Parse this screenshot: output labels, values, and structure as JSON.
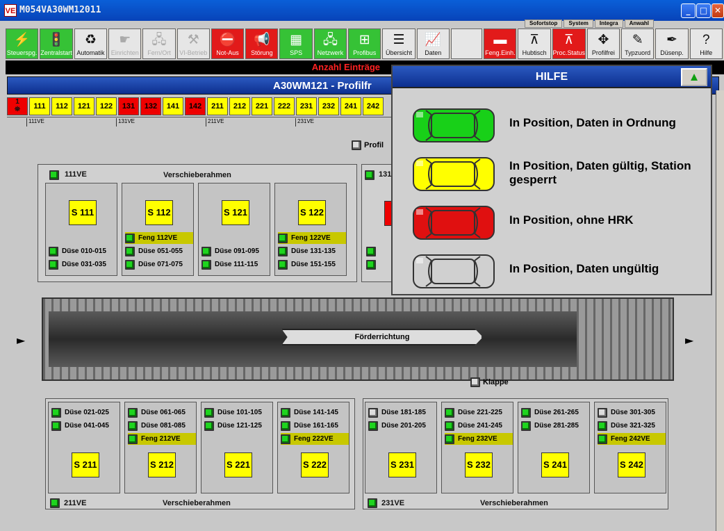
{
  "window": {
    "title": "M054VA30WM12011",
    "icon": "VE"
  },
  "top_tabs": [
    "Sofortstop",
    "System",
    "Integra",
    "Anwahl"
  ],
  "toolbar": [
    {
      "label": "Steuerspg.",
      "icon": "lightning-icon",
      "glyph": "⚡",
      "style": "green"
    },
    {
      "label": "Zentralstart",
      "icon": "traffic-light-icon",
      "glyph": "🚦",
      "style": "green"
    },
    {
      "label": "Automatik",
      "icon": "cycle-icon",
      "glyph": "♻",
      "style": "gray"
    },
    {
      "label": "Einrichten",
      "icon": "hand-icon",
      "glyph": "☛",
      "style": "gray-dis"
    },
    {
      "label": "Fern/Ort",
      "icon": "network-pc-icon",
      "glyph": "🖧",
      "style": "gray-dis"
    },
    {
      "label": "VI-Betrieb",
      "icon": "tools-icon",
      "glyph": "⚒",
      "style": "gray-dis"
    },
    {
      "label": "Not-Aus",
      "icon": "stop-icon",
      "glyph": "⛔",
      "style": "red"
    },
    {
      "label": "Störung",
      "icon": "horn-icon",
      "glyph": "📢",
      "style": "red"
    },
    {
      "label": "SPS",
      "icon": "plc-icon",
      "glyph": "▦",
      "style": "green"
    },
    {
      "label": "Netzwerk",
      "icon": "network-icon",
      "glyph": "🖧",
      "style": "green"
    },
    {
      "label": "Profibus",
      "icon": "bus-icon",
      "glyph": "⊞",
      "style": "green"
    },
    {
      "label": "Übersicht",
      "icon": "list-icon",
      "glyph": "☰",
      "style": "gray"
    },
    {
      "label": "Daten",
      "icon": "chart-icon",
      "glyph": "📈",
      "style": "gray"
    },
    {
      "label": "",
      "icon": "blank-icon",
      "glyph": "",
      "style": "gray"
    },
    {
      "label": "Feng.Einh.",
      "icon": "feng-icon",
      "glyph": "▬",
      "style": "red"
    },
    {
      "label": "Hubtisch",
      "icon": "lift-table-icon",
      "glyph": "⊼",
      "style": "gray"
    },
    {
      "label": "Proc.Status",
      "icon": "process-icon",
      "glyph": "⊼",
      "style": "red"
    },
    {
      "label": "Profilfrei",
      "icon": "arrows-icon",
      "glyph": "✥",
      "style": "gray"
    },
    {
      "label": "Typzuord",
      "icon": "type-assign-icon",
      "glyph": "✎",
      "style": "gray"
    },
    {
      "label": "Düsenp.",
      "icon": "nozzle-icon",
      "glyph": "✒",
      "style": "gray"
    },
    {
      "label": "Hilfe",
      "icon": "help-icon",
      "glyph": "?",
      "style": "gray"
    }
  ],
  "status_text": "Anzahl Einträge",
  "header_title": "A30WM121 - Profilfr",
  "stations": [
    {
      "label": "111",
      "color": "yellow"
    },
    {
      "label": "112",
      "color": "yellow"
    },
    {
      "label": "121",
      "color": "yellow"
    },
    {
      "label": "122",
      "color": "yellow"
    },
    {
      "label": "131",
      "color": "red"
    },
    {
      "label": "132",
      "color": "red"
    },
    {
      "label": "141",
      "color": "yellow"
    },
    {
      "label": "142",
      "color": "red"
    },
    {
      "label": "211",
      "color": "yellow"
    },
    {
      "label": "212",
      "color": "yellow"
    },
    {
      "label": "221",
      "color": "yellow"
    },
    {
      "label": "222",
      "color": "yellow"
    },
    {
      "label": "231",
      "color": "yellow"
    },
    {
      "label": "232",
      "color": "yellow"
    },
    {
      "label": "241",
      "color": "yellow"
    },
    {
      "label": "242",
      "color": "yellow"
    }
  ],
  "first_station": "1",
  "ruler": [
    "111VE",
    "131VE",
    "211VE",
    "231VE"
  ],
  "profil_label": "Profil",
  "top_frame": {
    "ve": "111VE",
    "title": "Verschieberahmen",
    "ve2": "131"
  },
  "bottom_frame_left": {
    "ve": "211VE",
    "title": "Verschieberahmen"
  },
  "bottom_frame_right": {
    "ve": "231VE",
    "title": "Verschieberahmen"
  },
  "top_cells": [
    {
      "station": "S 111",
      "feng": "",
      "rows": [
        "Düse 010-015",
        "Düse 031-035"
      ]
    },
    {
      "station": "S 112",
      "feng": "Feng 112VE",
      "rows": [
        "Düse 051-055",
        "Düse 071-075"
      ]
    },
    {
      "station": "S 121",
      "feng": "",
      "rows": [
        "Düse 091-095",
        "Düse 111-115"
      ]
    },
    {
      "station": "S 122",
      "feng": "Feng 122VE",
      "rows": [
        "Düse 131-135",
        "Düse 151-155"
      ]
    }
  ],
  "bottom_cells": [
    {
      "station": "S 211",
      "feng": "",
      "rows": [
        "Düse 021-025",
        "Düse 041-045"
      ],
      "leds": [
        "green",
        "green"
      ]
    },
    {
      "station": "S 212",
      "feng": "Feng 212VE",
      "rows": [
        "Düse 061-065",
        "Düse 081-085"
      ],
      "leds": [
        "green",
        "green"
      ]
    },
    {
      "station": "S 221",
      "feng": "",
      "rows": [
        "Düse 101-105",
        "Düse 121-125"
      ],
      "leds": [
        "green",
        "green"
      ]
    },
    {
      "station": "S 222",
      "feng": "Feng 222VE",
      "rows": [
        "Düse 141-145",
        "Düse 161-165"
      ],
      "leds": [
        "green",
        "green"
      ]
    },
    {
      "station": "S 231",
      "feng": "",
      "rows": [
        "Düse 181-185",
        "Düse 201-205"
      ],
      "leds": [
        "gray",
        "green"
      ]
    },
    {
      "station": "S 232",
      "feng": "Feng 232VE",
      "rows": [
        "Düse 221-225",
        "Düse 241-245"
      ],
      "leds": [
        "green",
        "green"
      ]
    },
    {
      "station": "S 241",
      "feng": "",
      "rows": [
        "Düse 261-265",
        "Düse 281-285"
      ],
      "leds": [
        "green",
        "green"
      ]
    },
    {
      "station": "S 242",
      "feng": "Feng 242VE",
      "rows": [
        "Düse 301-305",
        "Düse 321-325"
      ],
      "leds": [
        "gray",
        "green"
      ]
    }
  ],
  "conveyor_label": "Förderrichtung",
  "klappe_label": "Klappe",
  "hilfe": {
    "title": "HILFE",
    "legend": [
      {
        "color": "#18d018",
        "text": "In Position, Daten in Ordnung"
      },
      {
        "color": "#ffff00",
        "text": "In Position, Daten gültig, Station gesperrt"
      },
      {
        "color": "#e01010",
        "text": "In Position, ohne HRK"
      },
      {
        "color": "#d0d0d0",
        "text": "In Position, Daten ungültig"
      }
    ]
  }
}
